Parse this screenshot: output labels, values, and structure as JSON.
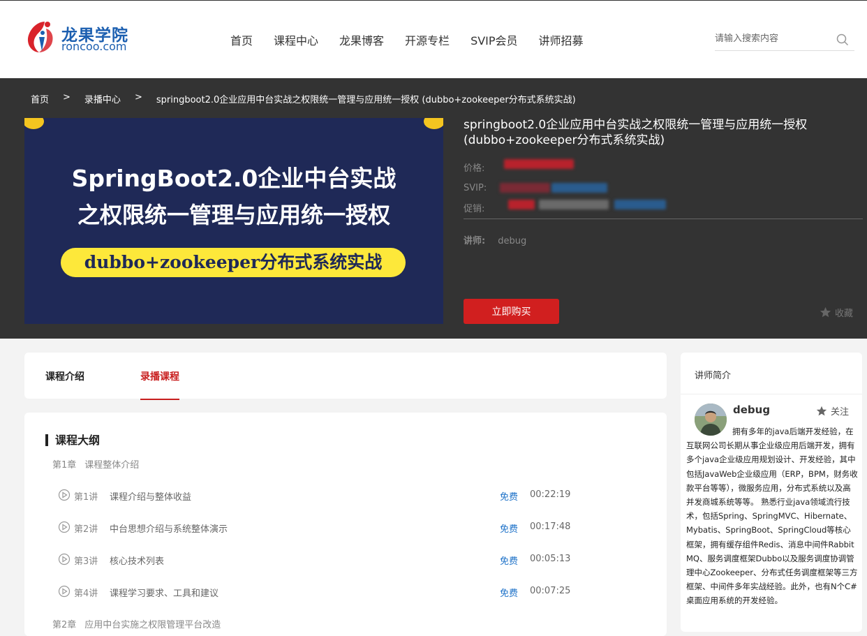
{
  "brand": {
    "name_cn": "龙果学院",
    "name_en": "roncoo.com"
  },
  "nav": [
    "首页",
    "课程中心",
    "龙果博客",
    "开源专栏",
    "SVIP会员",
    "讲师招募"
  ],
  "search": {
    "placeholder": "请输入搜索内容"
  },
  "breadcrumb": [
    "首页",
    ">",
    "录播中心",
    ">",
    "springboot2.0企业应用中台实战之权限统一管理与应用统一授权 (dubbo+zookeeper分布式系统实战)"
  ],
  "cover": {
    "line1": "SpringBoot2.0企业中台实战",
    "line2": "之权限统一管理与应用统一授权",
    "pill": "dubbo+zookeeper分布式系统实战"
  },
  "course": {
    "title": "springboot2.0企业应用中台实战之权限统一管理与应用统一授权 (dubbo+zookeeper分布式系统实战)",
    "price_label": "价格:",
    "svip_label": "SVIP:",
    "promo_label": "促销:",
    "teacher_label": "讲师:",
    "teacher_name": "debug",
    "buy_label": "立即购买",
    "fav_label": "收藏"
  },
  "tabs": [
    "课程介绍",
    "录播课程"
  ],
  "outline": {
    "title": "课程大纲",
    "chapters": [
      {
        "num": "第1章",
        "name": "课程整体介绍",
        "lessons": [
          {
            "num": "第1讲",
            "name": "课程介绍与整体收益",
            "tag": "免费",
            "duration": "00:22:19"
          },
          {
            "num": "第2讲",
            "name": "中台思想介绍与系统整体演示",
            "tag": "免费",
            "duration": "00:17:48"
          },
          {
            "num": "第3讲",
            "name": "核心技术列表",
            "tag": "免费",
            "duration": "00:05:13"
          },
          {
            "num": "第4讲",
            "name": "课程学习要求、工具和建议",
            "tag": "免费",
            "duration": "00:07:25"
          }
        ]
      },
      {
        "num": "第2章",
        "name": "应用中台实施之权限管理平台改造"
      }
    ]
  },
  "sidebar": {
    "title": "讲师简介",
    "teacher_name": "debug",
    "follow_label": "关注",
    "bio": "拥有多年的java后端开发经验，在互联网公司长期从事企业级应用后端开发，拥有多个java企业级应用规划设计、开发经验，其中包括JavaWeb企业级应用（ERP，BPM，财务收款平台等等），微服务应用，分布式系统以及高并发商城系统等等。 熟悉行业java领域流行技术，包括Spring、SpringMVC、Hibernate、Mybatis、SpringBoot、SpringCloud等核心框架，拥有缓存组件Redis、消息中间件RabbitMQ、服务调度框架Dubbo以及服务调度协调管理中心Zookeeper、分布式任务调度框架等三方框架、中间件多年实战经验。此外，也有N个C#桌面应用系统的开发经验。"
  },
  "colors": {
    "accent": "#d11f1f",
    "free": "#1e72c8",
    "hero_bg": "#333333",
    "cover_bg": "#1f2957",
    "pill": "#fde83a"
  }
}
